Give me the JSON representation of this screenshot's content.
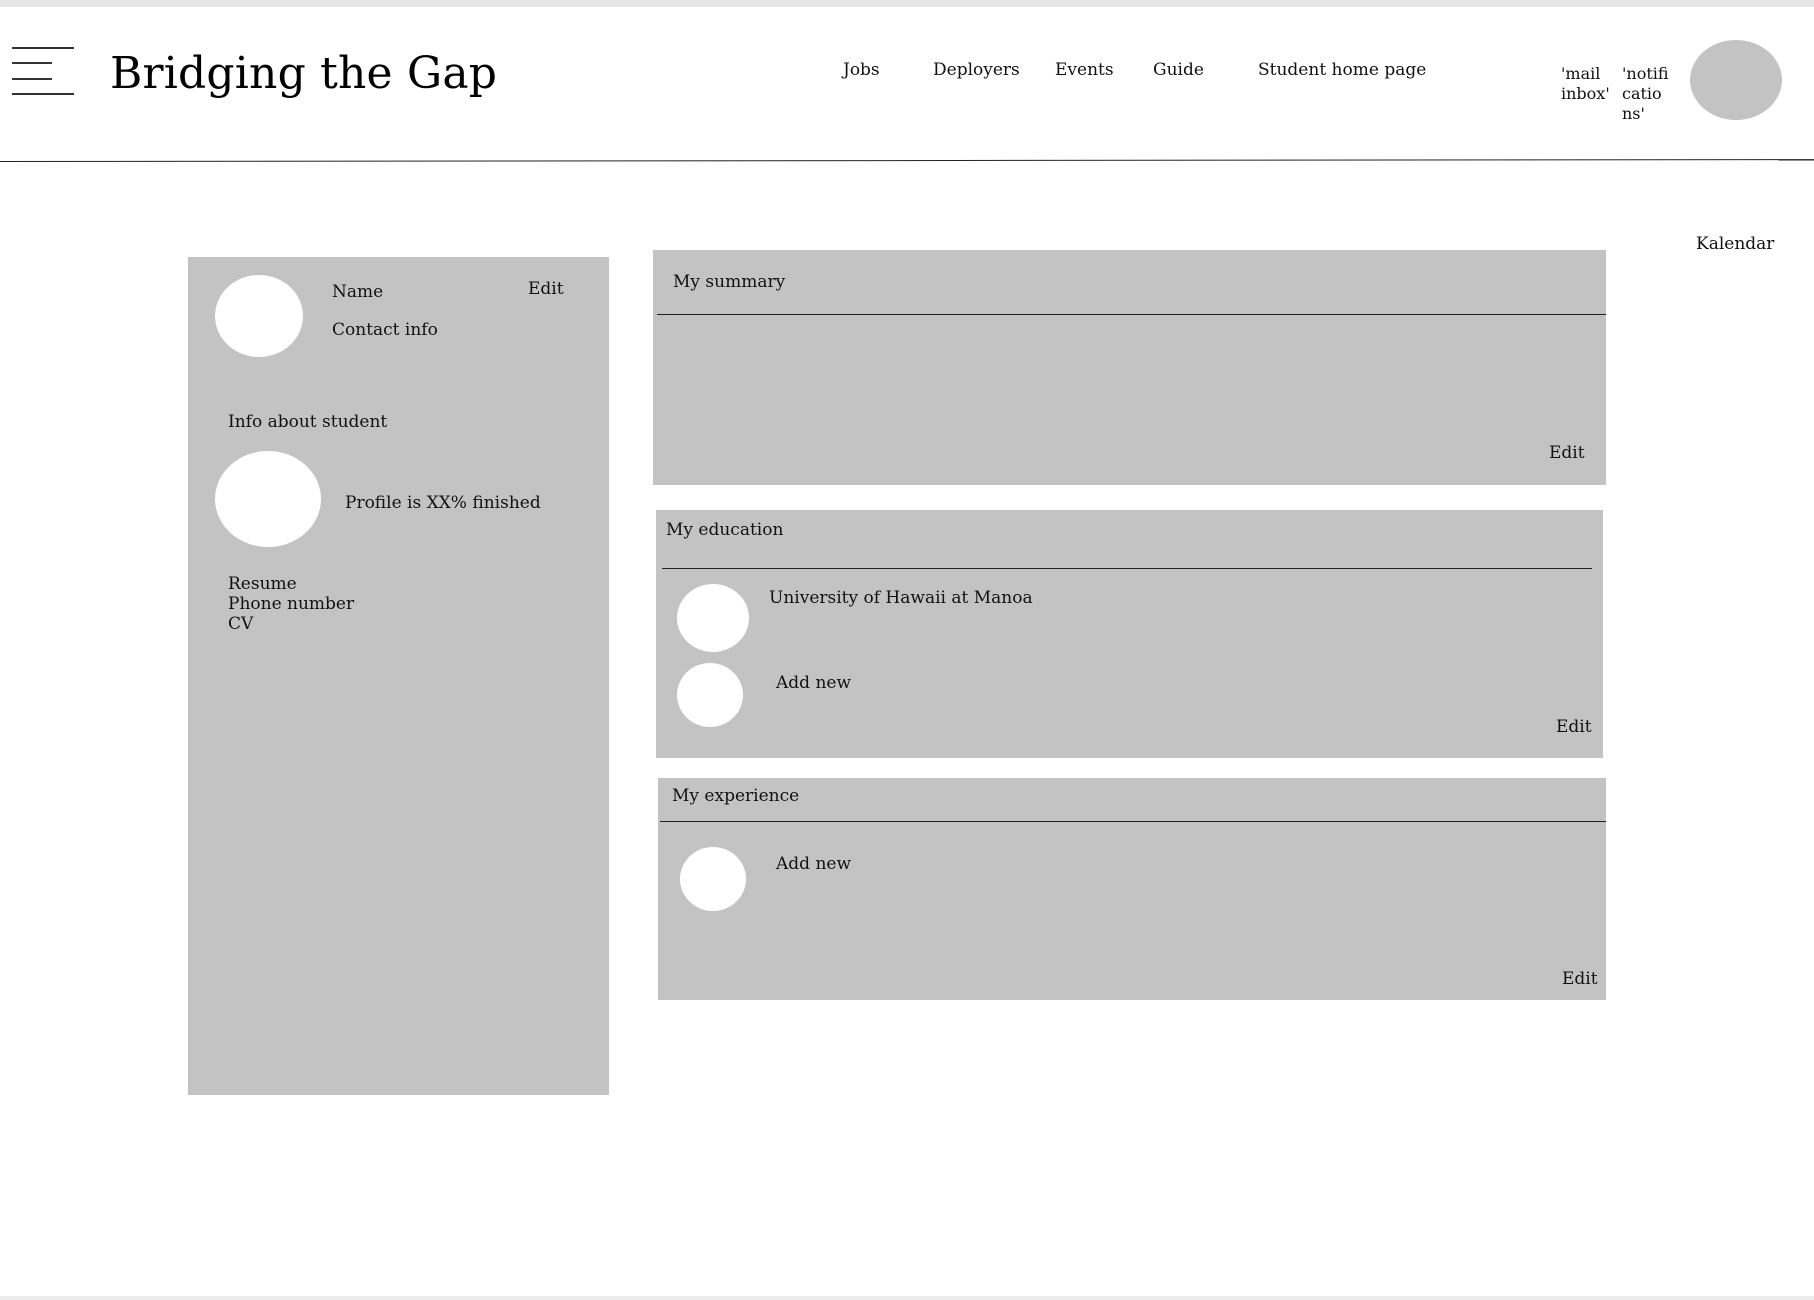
{
  "header": {
    "brand": "Bridging the Gap",
    "nav": [
      {
        "label": "Jobs"
      },
      {
        "label": "Deployers"
      },
      {
        "label": "Events"
      },
      {
        "label": "Guide"
      },
      {
        "label": "Student home page"
      }
    ],
    "mail_lines": [
      "'mail",
      "inbox'"
    ],
    "notif_lines": [
      "'notifi",
      "catio",
      "ns'"
    ]
  },
  "calendar_label": "Kalendar",
  "profile_card": {
    "name_label": "Name",
    "edit_label": "Edit",
    "contact_label": "Contact info",
    "info_heading": "Info about student",
    "progress_text": "Profile is XX% finished",
    "links": [
      "Resume",
      "Phone number",
      "CV"
    ]
  },
  "summary": {
    "title": "My summary",
    "edit_label": "Edit"
  },
  "education": {
    "title": "My education",
    "entries": [
      {
        "name": "University of Hawaii at Manoa"
      }
    ],
    "add_label": "Add new",
    "edit_label": "Edit"
  },
  "experience": {
    "title": "My experience",
    "add_label": "Add new",
    "edit_label": "Edit"
  },
  "colors": {
    "panel": "#c3c3c3",
    "avatar": "#c3c3c3",
    "background": "#ffffff",
    "text": "#111111"
  }
}
